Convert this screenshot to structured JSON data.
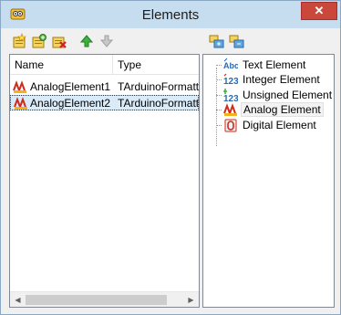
{
  "window": {
    "title": "Elements",
    "close_glyph": "✕"
  },
  "toolbar": {
    "left_buttons": [
      {
        "icon": "add-element-icon"
      },
      {
        "icon": "add-group-icon"
      },
      {
        "icon": "delete-element-icon"
      },
      {
        "icon": "move-up-icon"
      },
      {
        "icon": "move-down-icon",
        "disabled": true
      }
    ],
    "right_buttons": [
      {
        "icon": "expand-tree-icon"
      },
      {
        "icon": "collapse-tree-icon"
      }
    ]
  },
  "list": {
    "columns": [
      "Name",
      "Type"
    ],
    "rows": [
      {
        "name": "AnalogElement1",
        "type": "TArduinoFormatte",
        "icon": "analog-icon",
        "selected": false
      },
      {
        "name": "AnalogElement2",
        "type": "TArduinoFormatte",
        "icon": "analog-icon",
        "selected": true
      }
    ],
    "scroll_left": "◀",
    "scroll_right": "▶"
  },
  "palette": {
    "items": [
      {
        "label": "Text Element",
        "icon": "text-abc-icon"
      },
      {
        "label": "Integer Element",
        "icon": "integer-123-icon"
      },
      {
        "label": "Unsigned Element",
        "icon": "unsigned-123-icon"
      },
      {
        "label": "Analog Element",
        "icon": "analog-icon",
        "highlighted": true
      },
      {
        "label": "Digital Element",
        "icon": "digital-icon"
      }
    ]
  },
  "colors": {
    "titlebar": "#c6dcef",
    "close": "#c9483b",
    "selection": "#d9ebf9"
  }
}
